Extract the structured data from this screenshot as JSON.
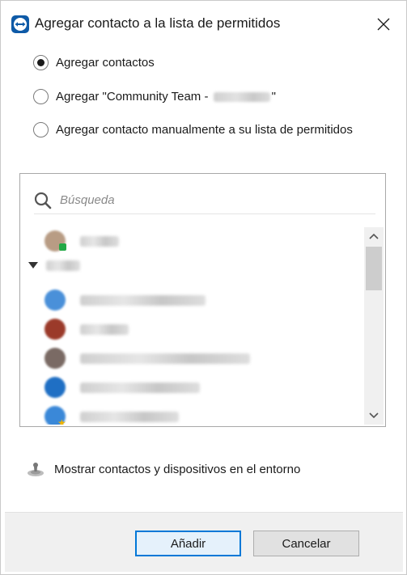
{
  "window": {
    "title": "Agregar contacto a la lista de permitidos",
    "icon": "teamviewer-logo-icon",
    "accent_color": "#0e5aa7"
  },
  "options": [
    {
      "label": "Agregar contactos",
      "checked": true
    },
    {
      "label_prefix": "Agregar \"Community Team - ",
      "label_suffix": "\"",
      "checked": false
    },
    {
      "label": "Agregar contacto manualmente a su lista de permitidos",
      "checked": false
    }
  ],
  "search": {
    "placeholder": "Búsqueda",
    "value": ""
  },
  "contacts": [
    {
      "avatar_color": "#b89c84",
      "status": "online"
    },
    {
      "avatar_color": "#4a90d9"
    },
    {
      "avatar_color": "#9b3a2a"
    },
    {
      "avatar_color": "#7a6a64"
    },
    {
      "avatar_color": "#1f6fc4"
    },
    {
      "avatar_color": "#3a88d8",
      "status": "starred"
    }
  ],
  "nearby": {
    "label": "Mostrar contactos y dispositivos en el entorno"
  },
  "buttons": {
    "add": "Añadir",
    "cancel": "Cancelar"
  }
}
